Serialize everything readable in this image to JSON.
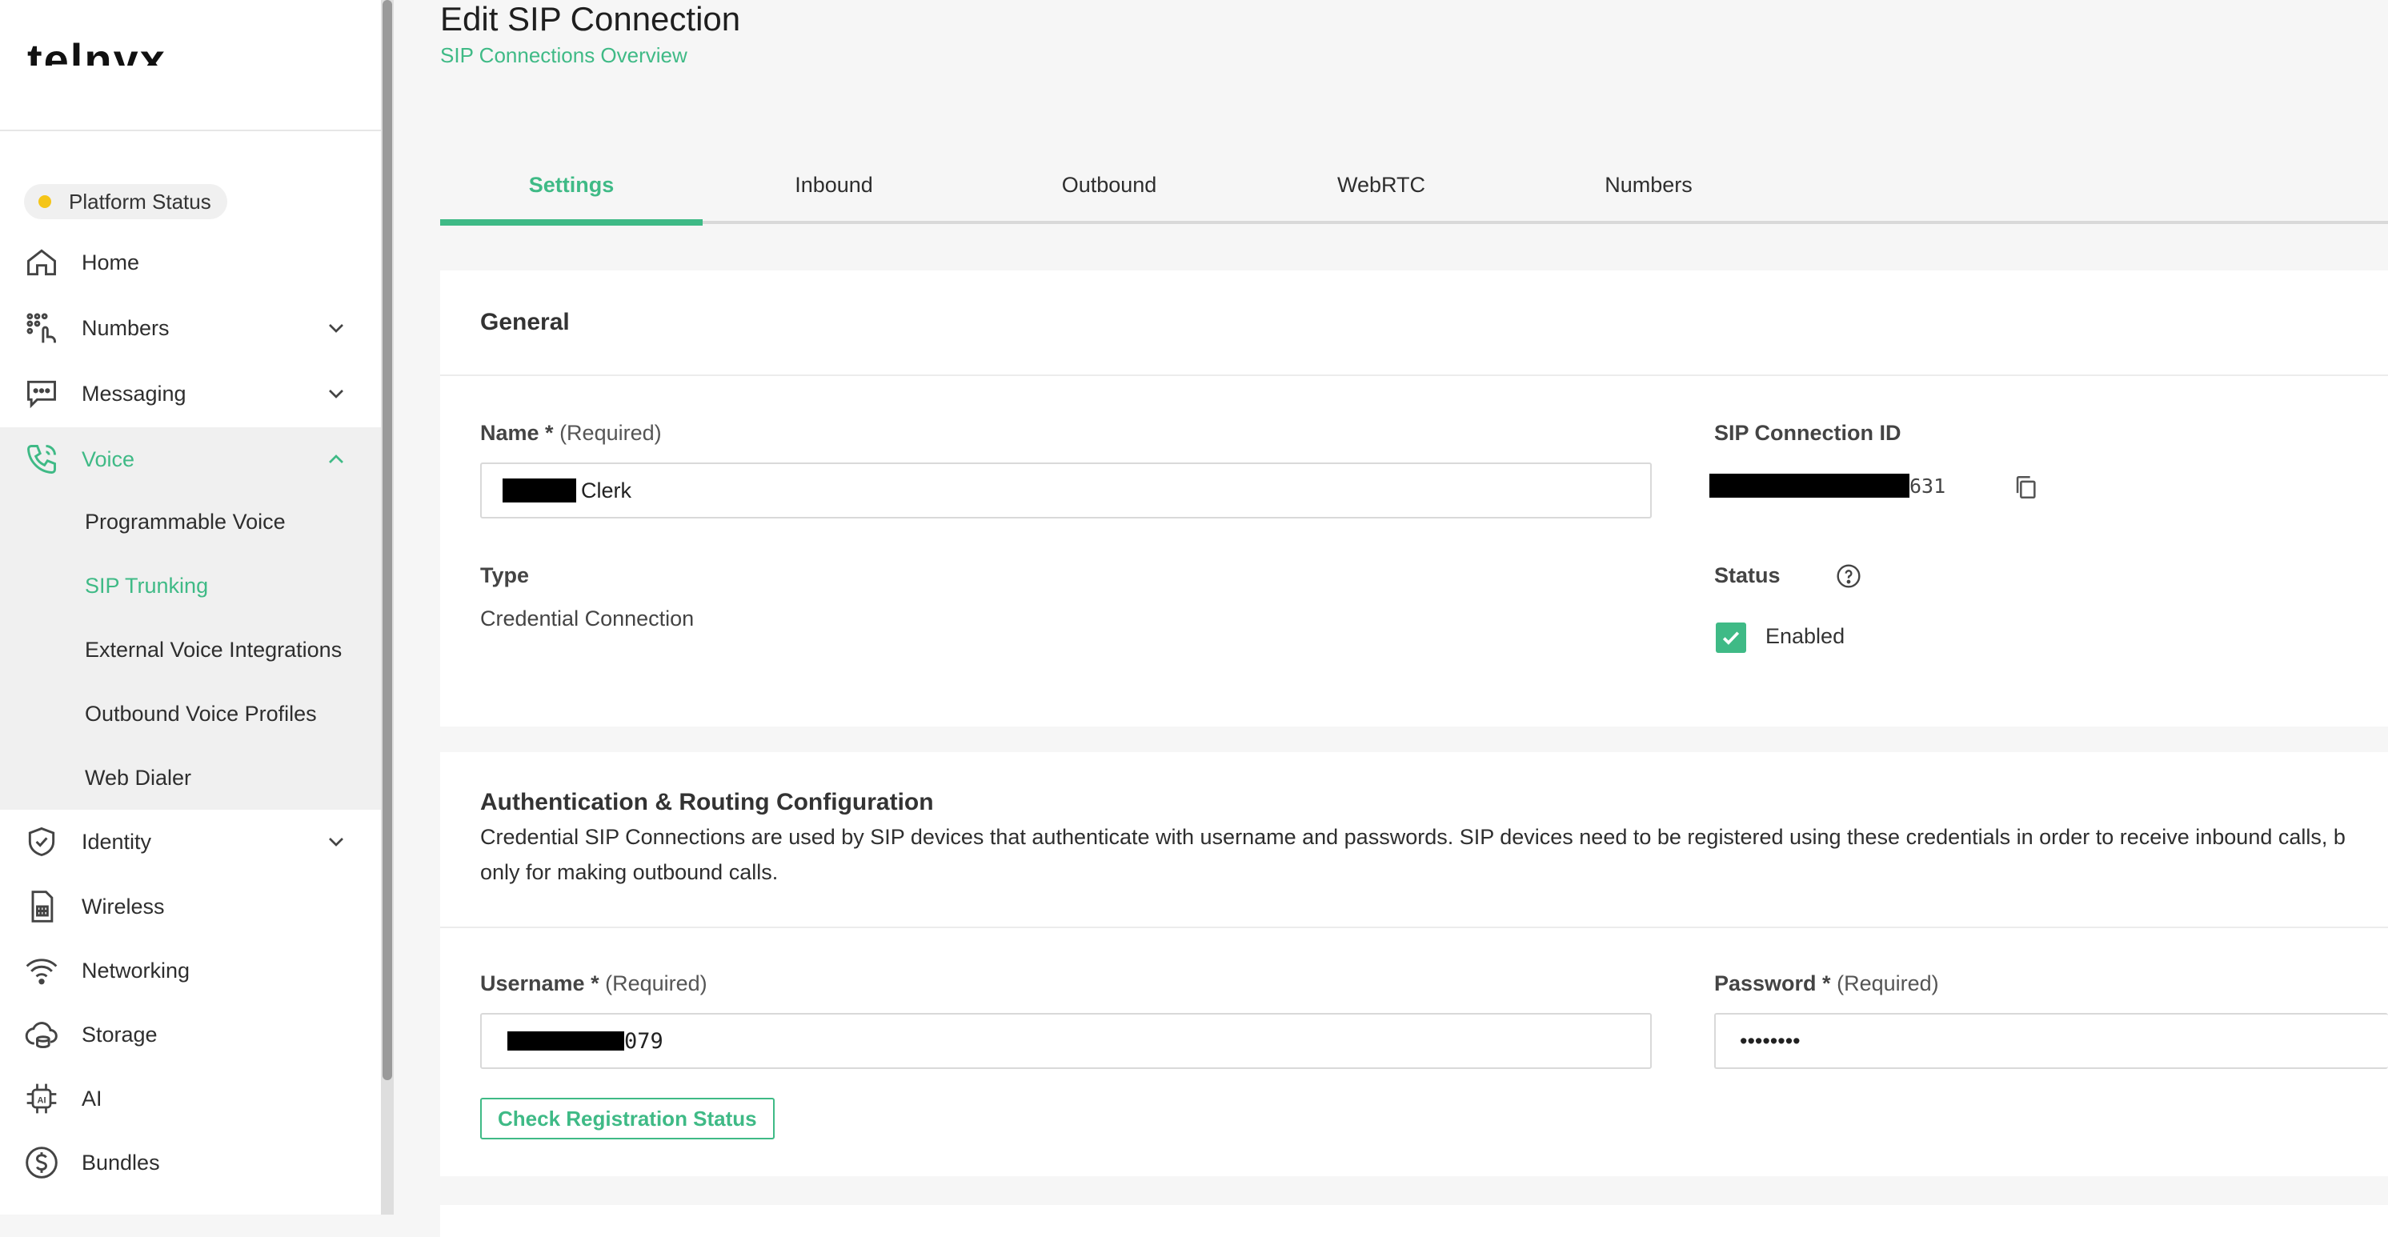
{
  "brand": {
    "logo_text": "telnyx"
  },
  "sidebar": {
    "platform_status": "Platform Status",
    "items": [
      {
        "label": "Home",
        "icon": "home-icon"
      },
      {
        "label": "Numbers",
        "icon": "numbers-icon"
      },
      {
        "label": "Messaging",
        "icon": "messaging-icon"
      },
      {
        "label": "Voice",
        "icon": "voice-icon"
      },
      {
        "label": "Identity",
        "icon": "identity-icon"
      },
      {
        "label": "Wireless",
        "icon": "wireless-icon"
      },
      {
        "label": "Networking",
        "icon": "networking-icon"
      },
      {
        "label": "Storage",
        "icon": "storage-icon"
      },
      {
        "label": "AI",
        "icon": "ai-icon"
      },
      {
        "label": "Bundles",
        "icon": "bundles-icon"
      }
    ],
    "voice_sub": [
      {
        "label": "Programmable Voice"
      },
      {
        "label": "SIP Trunking"
      },
      {
        "label": "External Voice Integrations"
      },
      {
        "label": "Outbound Voice Profiles"
      },
      {
        "label": "Web Dialer"
      }
    ]
  },
  "header": {
    "title": "Edit SIP Connection",
    "breadcrumb": "SIP Connections Overview"
  },
  "tabs": [
    {
      "label": "Settings"
    },
    {
      "label": "Inbound"
    },
    {
      "label": "Outbound"
    },
    {
      "label": "WebRTC"
    },
    {
      "label": "Numbers"
    }
  ],
  "general": {
    "title": "General",
    "name_label": "Name *",
    "name_required": "(Required)",
    "name_value": "Clerk",
    "sip_id_label": "SIP Connection ID",
    "sip_id_value": "631",
    "type_label": "Type",
    "type_value": "Credential Connection",
    "status_label": "Status",
    "enabled_label": "Enabled"
  },
  "auth": {
    "title": "Authentication & Routing Configuration",
    "description_line1": "Credential SIP Connections are used by SIP devices that authenticate with username and passwords. SIP devices need to be registered using these credentials in order to receive inbound calls, b",
    "description_line2": "only for making outbound calls.",
    "username_label": "Username *",
    "username_required": "(Required)",
    "username_value": "079",
    "password_label": "Password *",
    "password_required": "(Required)",
    "password_value": "••••••••",
    "check_button": "Check Registration Status"
  },
  "colors": {
    "accent": "#3fba86",
    "status_dot": "#f5c518"
  }
}
